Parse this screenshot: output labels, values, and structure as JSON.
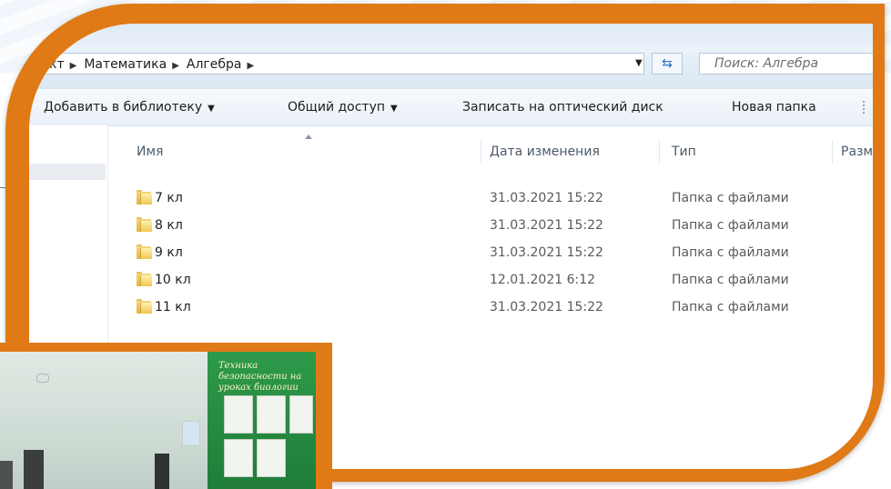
{
  "addressbar": {
    "breadcrumbs": [
      "кт",
      "Математика",
      "Алгебра"
    ],
    "search_placeholder": "Поиск: Алгебра"
  },
  "toolbar": {
    "add_to_library": "Добавить в библиотеку",
    "share": "Общий доступ",
    "burn": "Записать на оптический диск",
    "new_folder": "Новая папка"
  },
  "columns": {
    "name": "Имя",
    "date": "Дата изменения",
    "type": "Тип",
    "size": "Разм"
  },
  "files": [
    {
      "name": "7 кл",
      "date": "31.03.2021 15:22",
      "type": "Папка с файлами"
    },
    {
      "name": "8 кл",
      "date": "31.03.2021 15:22",
      "type": "Папка с файлами"
    },
    {
      "name": "9 кл",
      "date": "31.03.2021 15:22",
      "type": "Папка с файлами"
    },
    {
      "name": "10 кл",
      "date": "12.01.2021 6:12",
      "type": "Папка с файлами"
    },
    {
      "name": "11 кл",
      "date": "31.03.2021 15:22",
      "type": "Папка с файлами"
    }
  ],
  "photo": {
    "board_title": "Техника безопасности на уроках биологии"
  },
  "colors": {
    "frame": "#e07a16",
    "folder": "#f0c650",
    "accent_blue": "#2a6fc2"
  },
  "icons": [
    "breadcrumb-arrow-icon",
    "dropdown-arrow-icon",
    "refresh-icon",
    "folder-icon",
    "sort-arrow-icon"
  ]
}
